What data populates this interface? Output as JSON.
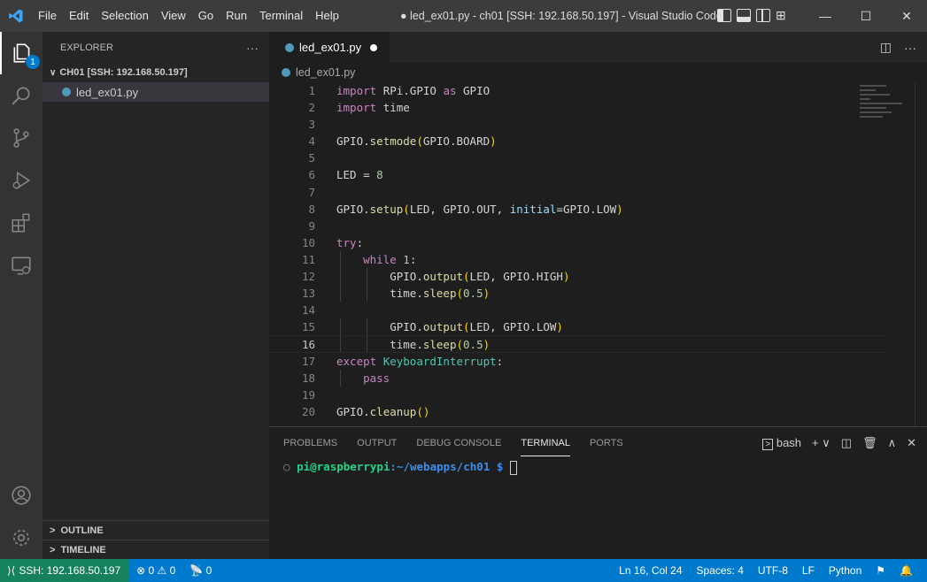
{
  "titlebar": {
    "app_icon": "vscode-logo-icon",
    "menus": [
      "File",
      "Edit",
      "Selection",
      "View",
      "Go",
      "Run",
      "Terminal",
      "Help"
    ],
    "title": "● led_ex01.py - ch01 [SSH: 192.168.50.197] - Visual Studio Code",
    "window_controls": {
      "minimize": "—",
      "maximize": "☐",
      "close": "✕"
    }
  },
  "activity_bar": {
    "items": [
      "explorer-icon",
      "search-icon",
      "source-control-icon",
      "run-debug-icon",
      "extensions-icon",
      "remote-explorer-icon"
    ],
    "explorer_badge": "1",
    "bottom": [
      "accounts-icon",
      "settings-gear-icon"
    ]
  },
  "sidebar": {
    "title": "EXPLORER",
    "more": "···",
    "folder": "CH01 [SSH: 192.168.50.197]",
    "files": [
      "led_ex01.py"
    ],
    "outline": "OUTLINE",
    "timeline": "TIMELINE"
  },
  "editor": {
    "tab_label": "led_ex01.py",
    "breadcrumb": "led_ex01.py",
    "cursor_line": 16,
    "lines": [
      "import RPi.GPIO as GPIO",
      "import time",
      "",
      "GPIO.setmode(GPIO.BOARD)",
      "",
      "LED = 8",
      "",
      "GPIO.setup(LED, GPIO.OUT, initial=GPIO.LOW)",
      "",
      "try:",
      "    while 1:",
      "        GPIO.output(LED, GPIO.HIGH)",
      "        time.sleep(0.5)",
      "",
      "        GPIO.output(LED, GPIO.LOW)",
      "        time.sleep(0.5)",
      "except KeyboardInterrupt:",
      "    pass",
      "",
      "GPIO.cleanup()"
    ]
  },
  "panel": {
    "tabs": [
      "PROBLEMS",
      "OUTPUT",
      "DEBUG CONSOLE",
      "TERMINAL",
      "PORTS"
    ],
    "active_tab": "TERMINAL",
    "shell": "bash",
    "prompt_user": "pi@raspberrypi",
    "prompt_path": ":~/webapps/ch01 $ "
  },
  "statusbar": {
    "remote": "SSH: 192.168.50.197",
    "problems": "⊗ 0 ⚠ 0",
    "ports": "0",
    "position": "Ln 16, Col 24",
    "spaces": "Spaces: 4",
    "encoding": "UTF-8",
    "eol": "LF",
    "language": "Python"
  }
}
